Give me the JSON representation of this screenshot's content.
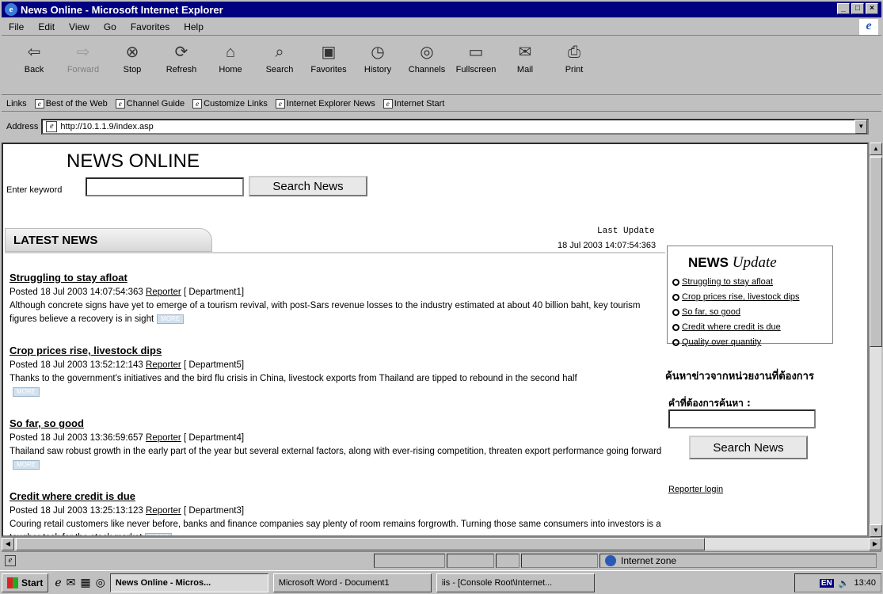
{
  "window": {
    "title": "News Online - Microsoft Internet Explorer"
  },
  "menu": [
    "File",
    "Edit",
    "View",
    "Go",
    "Favorites",
    "Help"
  ],
  "toolbar": [
    {
      "label": "Back",
      "icon": "back-arrow",
      "enabled": true
    },
    {
      "label": "Forward",
      "icon": "forward-arrow",
      "enabled": false
    },
    {
      "label": "Stop",
      "icon": "stop",
      "enabled": true
    },
    {
      "label": "Refresh",
      "icon": "refresh",
      "enabled": true
    },
    {
      "label": "Home",
      "icon": "home",
      "enabled": true
    },
    {
      "label": "Search",
      "icon": "search",
      "enabled": true
    },
    {
      "label": "Favorites",
      "icon": "favorites",
      "enabled": true
    },
    {
      "label": "History",
      "icon": "history",
      "enabled": true
    },
    {
      "label": "Channels",
      "icon": "channels",
      "enabled": true
    },
    {
      "label": "Fullscreen",
      "icon": "fullscreen",
      "enabled": true
    },
    {
      "label": "Mail",
      "icon": "mail",
      "enabled": true
    },
    {
      "label": "Print",
      "icon": "print",
      "enabled": true
    }
  ],
  "links": {
    "label": "Links",
    "items": [
      "Best of the Web",
      "Channel Guide",
      "Customize Links",
      "Internet Explorer News",
      "Internet Start"
    ]
  },
  "address": {
    "label": "Address",
    "url": "http://10.1.1.9/index.asp"
  },
  "page": {
    "site_title": "NEWS ONLINE",
    "keyword_label": "Enter keyword",
    "search_button": "Search News",
    "latest_label": "LATEST NEWS",
    "last_update_label": "Last Update",
    "last_update_date": "18 Jul 2003 14:07:54:363",
    "more_label": "MORE",
    "news": [
      {
        "title": "Struggling to stay afloat",
        "posted": "Posted 18 Jul 2003 14:07:54:363",
        "reporter": "Reporter",
        "dept": "[ Department1]",
        "body": "Although concrete signs have yet to emerge of a tourism revival, with post-Sars revenue losses to the industry estimated at about 40 billion baht, key tourism figures believe a recovery is in sight"
      },
      {
        "title": "Crop prices rise, livestock dips",
        "posted": "Posted 18 Jul 2003 13:52:12:143",
        "reporter": "Reporter",
        "dept": "[ Department5]",
        "body": "Thanks to the government's initiatives and the bird flu crisis in China, livestock exports from Thailand are tipped to rebound in the second half"
      },
      {
        "title": "So far, so good",
        "posted": "Posted 18 Jul 2003 13:36:59:657",
        "reporter": "Reporter",
        "dept": "[ Department4]",
        "body": "Thailand saw robust growth in the early part of the year but several external factors, along with ever-rising competition, threaten export performance going forward"
      },
      {
        "title": "Credit where credit is due",
        "posted": "Posted 18 Jul 2003 13:25:13:123",
        "reporter": "Reporter",
        "dept": "[ Department3]",
        "body": "Couring retail customers like never before, banks and finance companies say plenty of room remains forgrowth. Turning those same consumers into investors is a tougher task for the stock market"
      }
    ],
    "side": {
      "head_bold": "NEWS",
      "head_italic": "Update",
      "links": [
        "Struggling to stay afloat",
        "Crop prices rise, livestock dips",
        "So far, so good",
        "Credit where credit is due",
        "Quality over quantity"
      ],
      "thai_heading": "ค้นหาข่าวจากหน่วยงานที่ต้องการ",
      "thai_label": "คำที่ต้องการค้นหา :",
      "search_button": "Search News",
      "reporter_login": "Reporter login"
    }
  },
  "status": {
    "zone": "Internet zone"
  },
  "taskbar": {
    "start": "Start",
    "tasks": [
      "News Online - Micros...",
      "Microsoft Word - Document1",
      "iis - [Console Root\\Internet..."
    ],
    "lang": "EN",
    "clock": "13:40"
  }
}
